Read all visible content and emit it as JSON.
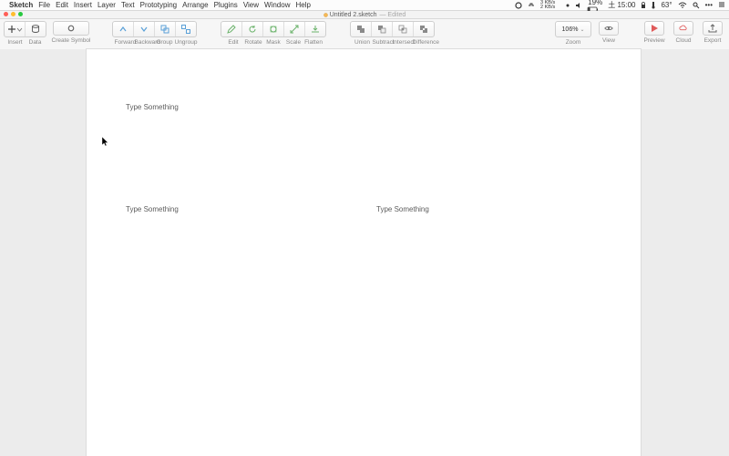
{
  "mac_menu": {
    "apple": "",
    "app": "Sketch",
    "items": [
      "File",
      "Edit",
      "Insert",
      "Layer",
      "Text",
      "Prototyping",
      "Arrange",
      "Plugins",
      "View",
      "Window",
      "Help"
    ]
  },
  "mac_status": {
    "net": "3 KB/s\n2 KB/s",
    "bt": "",
    "temp": "63°",
    "battery": "19%",
    "time": "土 15:00"
  },
  "window": {
    "title": "Untitled 2.sketch",
    "edited": "— Edited"
  },
  "toolbar": {
    "insert": {
      "label": "Insert"
    },
    "data": {
      "label": "Data"
    },
    "create_symbol": {
      "label": "Create Symbol"
    },
    "forward": {
      "label": "Forward"
    },
    "backward": {
      "label": "Backward"
    },
    "group": {
      "label": "Group"
    },
    "ungroup": {
      "label": "Ungroup"
    },
    "edit": {
      "label": "Edit"
    },
    "rotate": {
      "label": "Rotate"
    },
    "mask": {
      "label": "Mask"
    },
    "scale": {
      "label": "Scale"
    },
    "flatten": {
      "label": "Flatten"
    },
    "union": {
      "label": "Union"
    },
    "subtract": {
      "label": "Subtract"
    },
    "intersect": {
      "label": "Intersect"
    },
    "difference": {
      "label": "Difference"
    },
    "zoom": {
      "value": "106%",
      "label": "Zoom"
    },
    "view": {
      "label": "View"
    },
    "preview": {
      "label": "Preview"
    },
    "cloud": {
      "label": "Cloud"
    },
    "export": {
      "label": "Export"
    }
  },
  "canvas": {
    "texts": [
      {
        "value": "Type Something"
      },
      {
        "value": "Type Something"
      },
      {
        "value": "Type Something"
      }
    ]
  }
}
